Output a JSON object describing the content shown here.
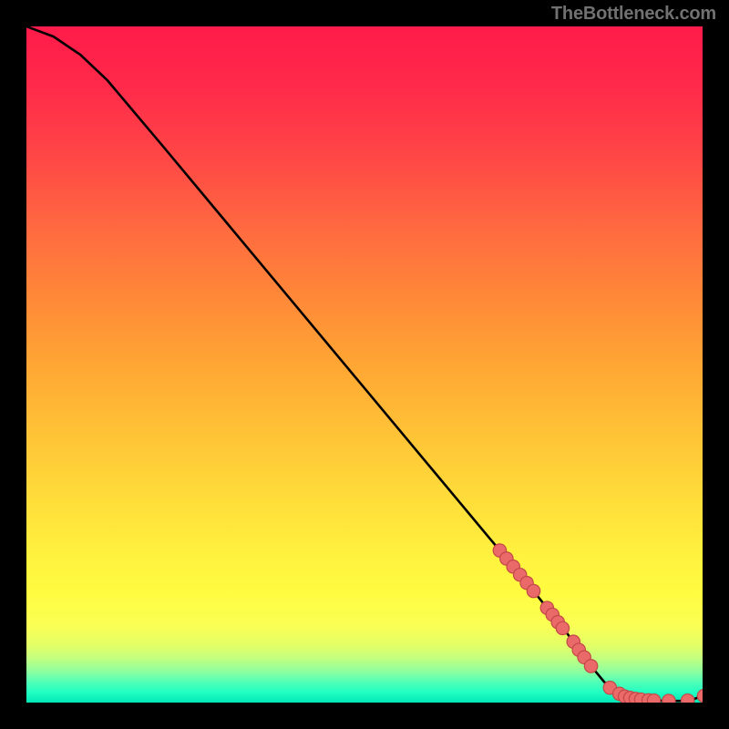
{
  "attribution": "TheBottleneck.com",
  "chart_data": {
    "type": "line",
    "title": "",
    "xlabel": "",
    "ylabel": "",
    "xlim": [
      0,
      100
    ],
    "ylim": [
      0,
      100
    ],
    "grid": false,
    "legend": false,
    "gradient_bands": [
      {
        "y": 0,
        "color": "#ff1b4a"
      },
      {
        "y": 50,
        "color": "#ffa634"
      },
      {
        "y": 80,
        "color": "#fff13e"
      },
      {
        "y": 100,
        "color": "#00e7b8"
      }
    ],
    "curve_points": [
      {
        "x": 0.0,
        "y": 100.0
      },
      {
        "x": 4.0,
        "y": 98.5
      },
      {
        "x": 8.0,
        "y": 95.8
      },
      {
        "x": 12.0,
        "y": 92.0
      },
      {
        "x": 20.0,
        "y": 82.5
      },
      {
        "x": 30.0,
        "y": 70.5
      },
      {
        "x": 40.0,
        "y": 58.5
      },
      {
        "x": 50.0,
        "y": 46.5
      },
      {
        "x": 60.0,
        "y": 34.5
      },
      {
        "x": 70.0,
        "y": 22.5
      },
      {
        "x": 75.0,
        "y": 16.5
      },
      {
        "x": 80.0,
        "y": 10.2
      },
      {
        "x": 83.0,
        "y": 6.0
      },
      {
        "x": 85.5,
        "y": 3.0
      },
      {
        "x": 88.0,
        "y": 1.2
      },
      {
        "x": 90.0,
        "y": 0.6
      },
      {
        "x": 92.0,
        "y": 0.3
      },
      {
        "x": 95.0,
        "y": 0.25
      },
      {
        "x": 98.0,
        "y": 0.25
      },
      {
        "x": 100.0,
        "y": 1.0
      }
    ],
    "markers": [
      {
        "x": 70.0,
        "y": 22.5
      },
      {
        "x": 71.0,
        "y": 21.3
      },
      {
        "x": 72.0,
        "y": 20.1
      },
      {
        "x": 73.0,
        "y": 18.9
      },
      {
        "x": 74.0,
        "y": 17.7
      },
      {
        "x": 75.0,
        "y": 16.5
      },
      {
        "x": 77.0,
        "y": 14.0
      },
      {
        "x": 77.8,
        "y": 13.0
      },
      {
        "x": 78.6,
        "y": 11.9
      },
      {
        "x": 79.3,
        "y": 11.0
      },
      {
        "x": 80.9,
        "y": 9.0
      },
      {
        "x": 81.7,
        "y": 7.8
      },
      {
        "x": 82.5,
        "y": 6.7
      },
      {
        "x": 83.5,
        "y": 5.4
      },
      {
        "x": 86.3,
        "y": 2.2
      },
      {
        "x": 87.7,
        "y": 1.3
      },
      {
        "x": 88.5,
        "y": 0.9
      },
      {
        "x": 89.3,
        "y": 0.7
      },
      {
        "x": 90.1,
        "y": 0.55
      },
      {
        "x": 90.9,
        "y": 0.45
      },
      {
        "x": 92.0,
        "y": 0.35
      },
      {
        "x": 92.8,
        "y": 0.3
      },
      {
        "x": 95.0,
        "y": 0.25
      },
      {
        "x": 97.8,
        "y": 0.3
      },
      {
        "x": 100.2,
        "y": 1.0
      }
    ]
  }
}
